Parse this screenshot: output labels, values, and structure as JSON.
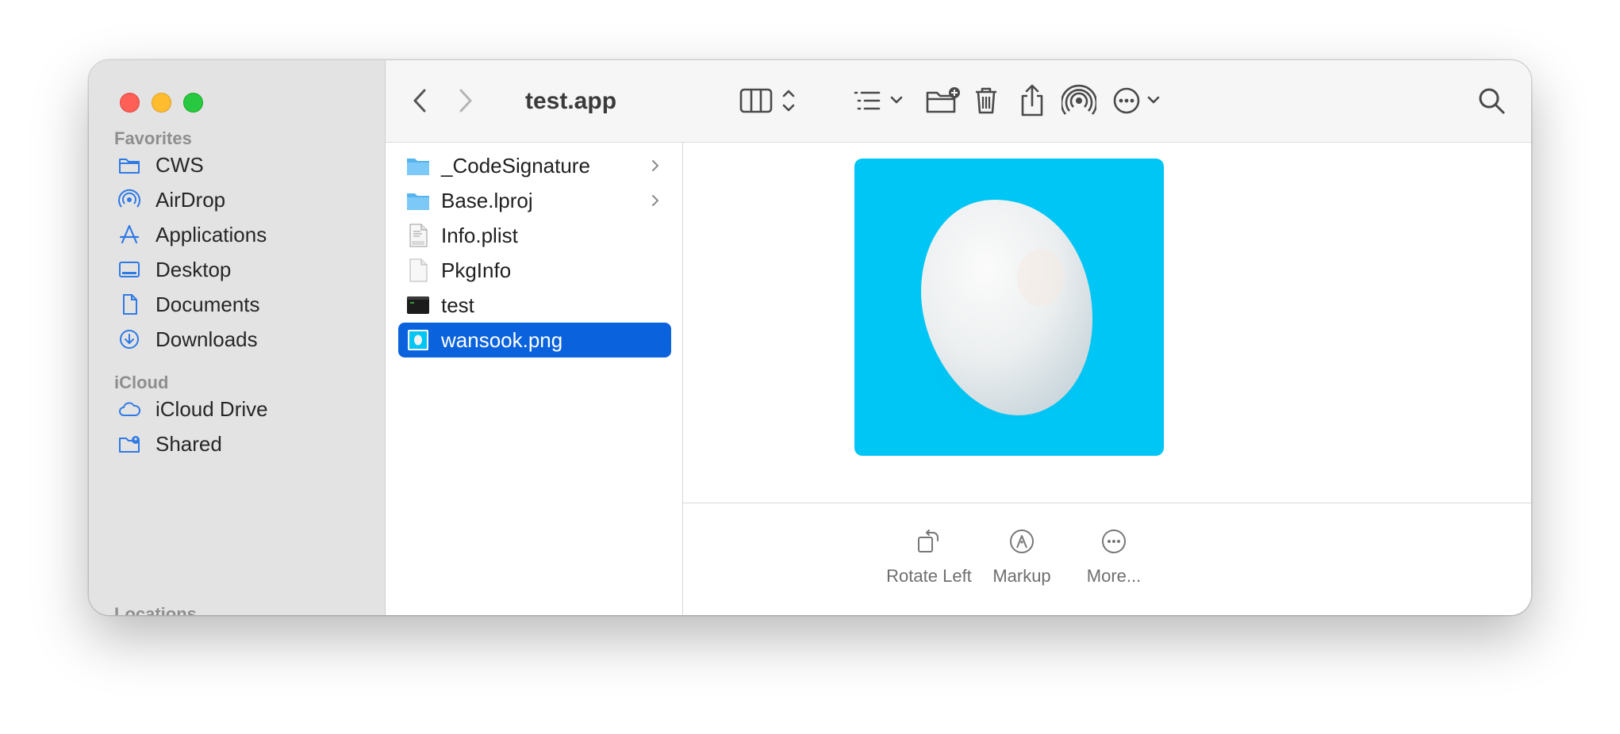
{
  "window": {
    "title": "test.app"
  },
  "sidebar": {
    "favorites_header": "Favorites",
    "favorites": [
      {
        "label": "CWS",
        "icon": "folder-icon"
      },
      {
        "label": "AirDrop",
        "icon": "airdrop-icon"
      },
      {
        "label": "Applications",
        "icon": "applications-icon"
      },
      {
        "label": "Desktop",
        "icon": "desktop-icon"
      },
      {
        "label": "Documents",
        "icon": "document-icon"
      },
      {
        "label": "Downloads",
        "icon": "download-icon"
      }
    ],
    "icloud_header": "iCloud",
    "icloud": [
      {
        "label": "iCloud Drive",
        "icon": "cloud-icon"
      },
      {
        "label": "Shared",
        "icon": "shared-folder-icon"
      }
    ],
    "locations_header": "Locations"
  },
  "files": [
    {
      "name": "_CodeSignature",
      "kind": "folder",
      "has_children": true
    },
    {
      "name": "Base.lproj",
      "kind": "folder",
      "has_children": true
    },
    {
      "name": "Info.plist",
      "kind": "plist",
      "has_children": false
    },
    {
      "name": "PkgInfo",
      "kind": "file",
      "has_children": false
    },
    {
      "name": "test",
      "kind": "executable",
      "has_children": false
    },
    {
      "name": "wansook.png",
      "kind": "image",
      "has_children": false,
      "selected": true
    }
  ],
  "preview": {
    "background_color": "#00c6f5",
    "actions": [
      {
        "label": "Rotate Left",
        "icon": "rotate-left-icon"
      },
      {
        "label": "Markup",
        "icon": "markup-icon"
      },
      {
        "label": "More...",
        "icon": "more-icon"
      }
    ]
  },
  "colors": {
    "accent": "#0a62dd",
    "sidebar_icon": "#2f7ae5",
    "close": "#fe5f57",
    "minimize": "#febc2e",
    "maximize": "#28c840"
  }
}
